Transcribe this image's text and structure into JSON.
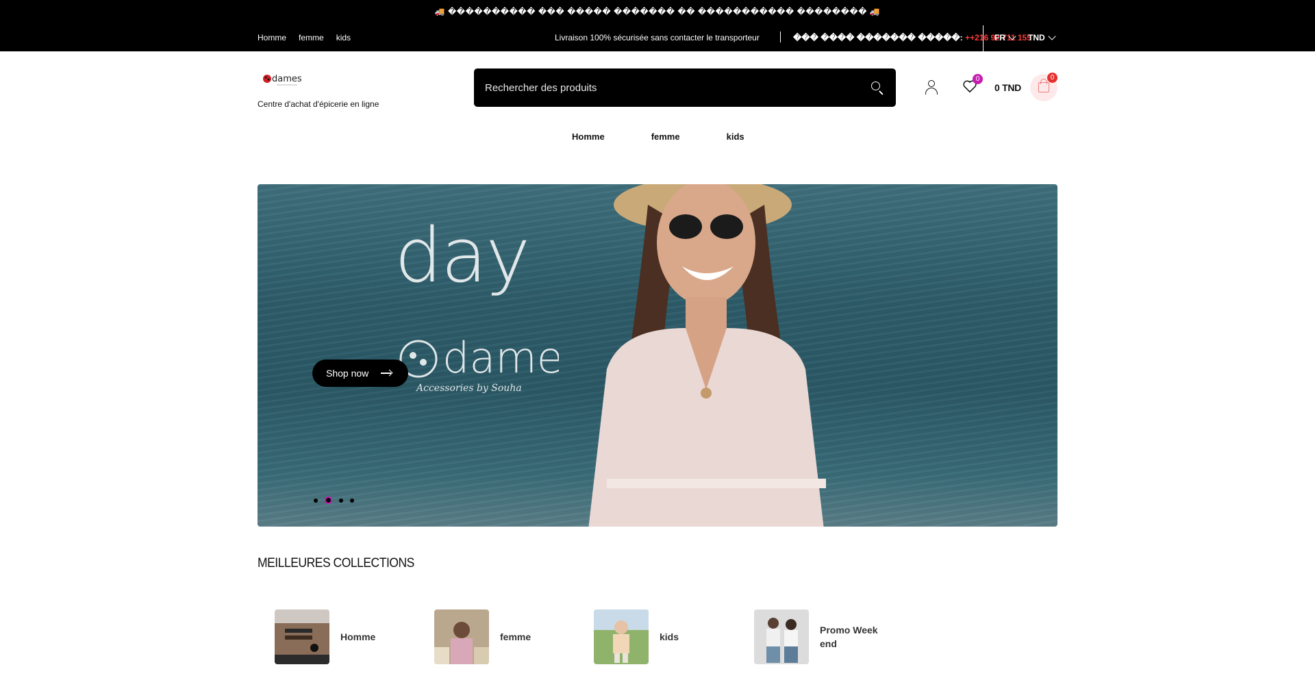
{
  "topbar": {
    "announcement": "🚚 ���������� ��� ����� ������� �� ����������� �������� 🚚",
    "nav": [
      "Homme",
      "femme",
      "kids"
    ],
    "delivery": "Livraison 100% sécurisée sans contacter le transporteur",
    "contact_label": "��� ���� ������� �����:",
    "contact_phone": "++216 92 711 155",
    "language": "FR",
    "currency": "TND"
  },
  "header": {
    "logo_text": "dames",
    "tagline": "Centre d'achat d'épicerie en ligne",
    "search_placeholder": "Rechercher des produits",
    "wishlist_count": "0",
    "cart_total": "0 TND",
    "cart_count": "0"
  },
  "main_nav": [
    "Homme",
    "femme",
    "kids"
  ],
  "hero": {
    "overlay_word": "day",
    "overlay_brand": "dames",
    "overlay_sub": "Accessories by Souha",
    "button_label": "Shop now",
    "slides": 4,
    "active_slide": 2
  },
  "collections": {
    "title": "MEILLEURES COLLECTIONS",
    "items": [
      {
        "label": "Homme"
      },
      {
        "label": "femme"
      },
      {
        "label": "kids"
      },
      {
        "label": "Promo Week end"
      }
    ]
  },
  "colors": {
    "accent_pink": "#c71bb3",
    "cart_red": "#e6302f",
    "phone_red": "#ff3b3b"
  }
}
